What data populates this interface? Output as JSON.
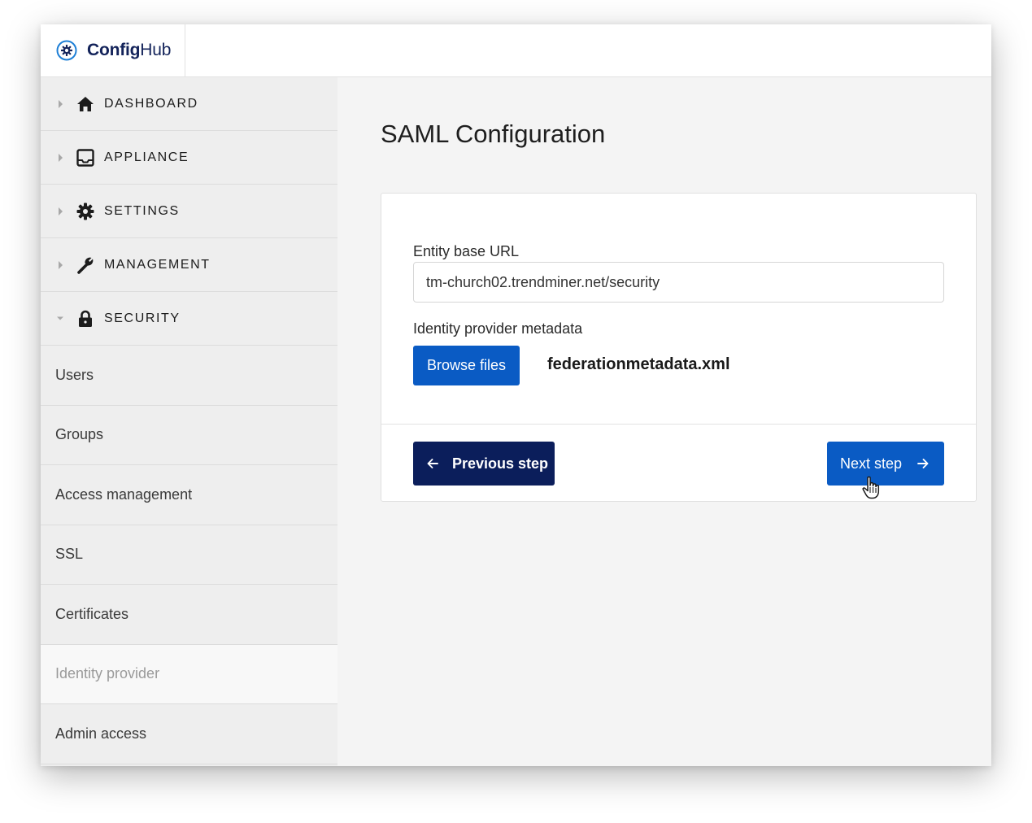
{
  "app": {
    "brand_prefix": "Config",
    "brand_suffix": "Hub"
  },
  "sidebar": {
    "sections": [
      {
        "label": "DASHBOARD",
        "icon": "home-icon",
        "expanded": false
      },
      {
        "label": "APPLIANCE",
        "icon": "appliance-icon",
        "expanded": false
      },
      {
        "label": "SETTINGS",
        "icon": "gear-icon",
        "expanded": false
      },
      {
        "label": "MANAGEMENT",
        "icon": "wrench-icon",
        "expanded": false
      },
      {
        "label": "SECURITY",
        "icon": "lock-icon",
        "expanded": true
      }
    ],
    "security_items": [
      {
        "label": "Users"
      },
      {
        "label": "Groups"
      },
      {
        "label": "Access management"
      },
      {
        "label": "SSL"
      },
      {
        "label": "Certificates"
      },
      {
        "label": "Identity provider",
        "active": true
      },
      {
        "label": "Admin access"
      }
    ]
  },
  "main": {
    "title": "SAML Configuration",
    "form": {
      "entity_label": "Entity base URL",
      "entity_value": "tm-church02.trendminer.net/security",
      "metadata_label": "Identity provider metadata",
      "browse_label": "Browse files",
      "file_name": "federationmetadata.xml"
    },
    "actions": {
      "previous_label": "Previous step",
      "next_label": "Next step"
    }
  },
  "colors": {
    "brand": "#13235a",
    "primary": "#0a5bc4",
    "dark_primary": "#0b1e5b",
    "sidebar_bg": "#eeeeee",
    "active_item_text": "#9a9a9a"
  }
}
